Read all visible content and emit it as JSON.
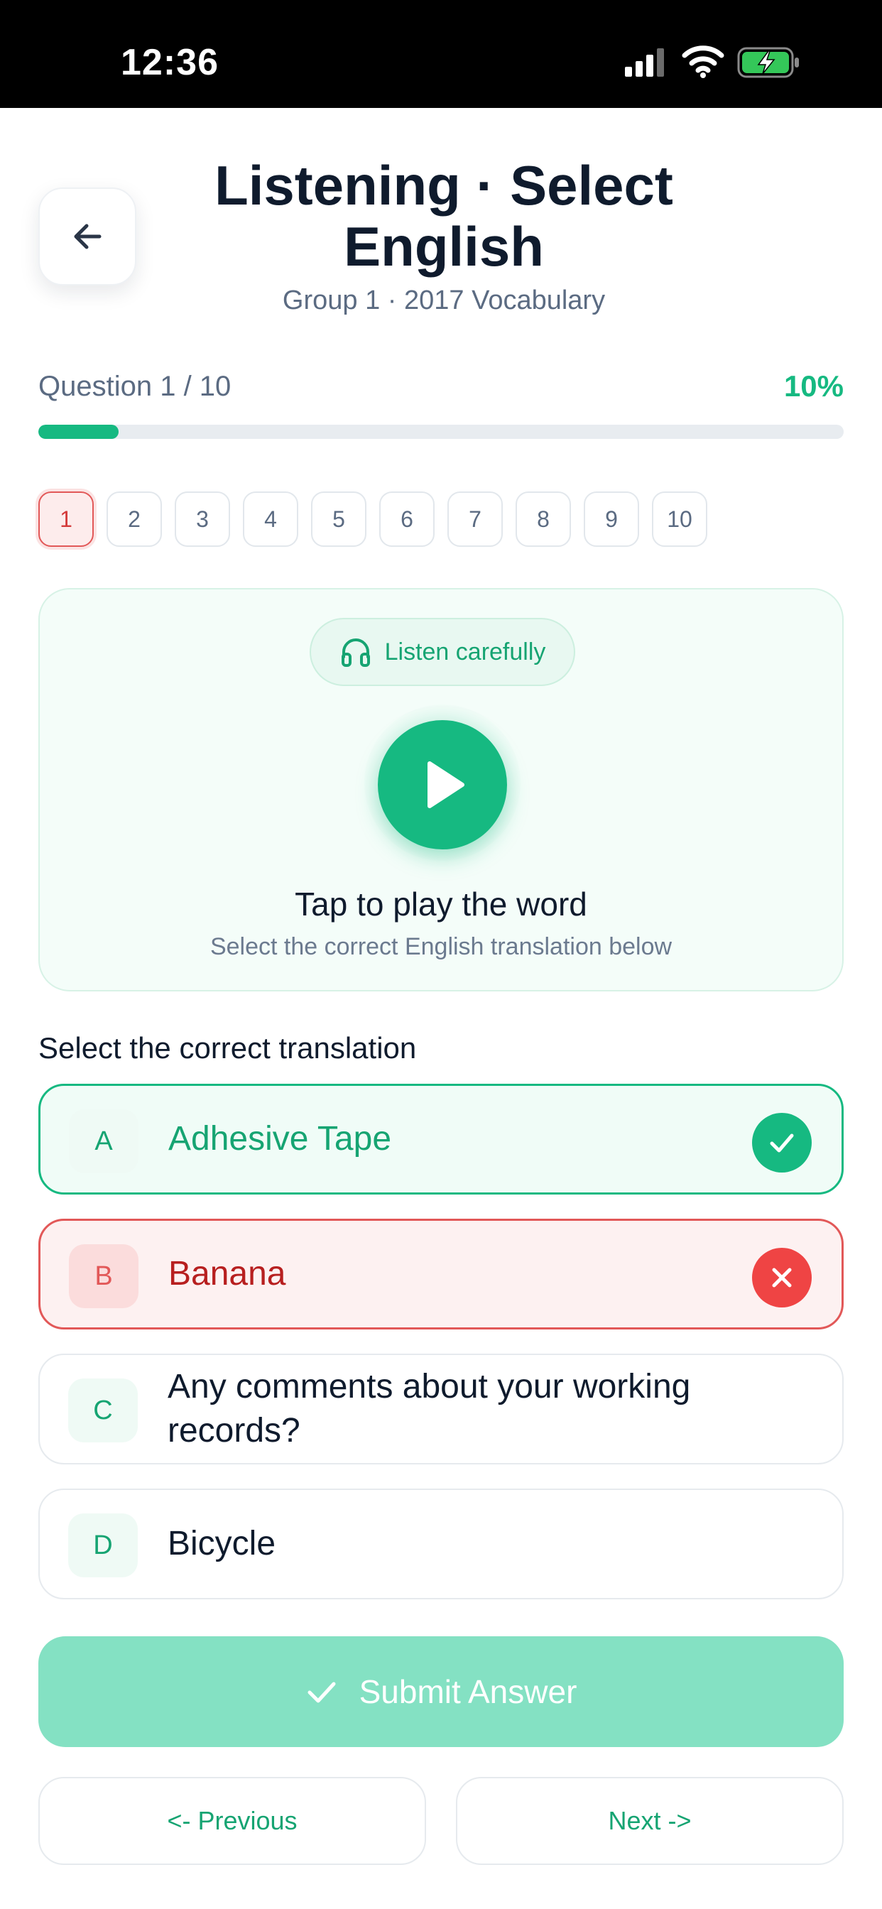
{
  "status_bar": {
    "time": "12:36"
  },
  "header": {
    "title": "Listening · Select English",
    "subtitle": "Group 1 · 2017 Vocabulary",
    "back_icon": "arrow-left-icon"
  },
  "progress": {
    "label": "Question 1 / 10",
    "percent_label": "10%",
    "fraction": 0.1,
    "accent": "#16b981"
  },
  "question_nav": [
    "1",
    "2",
    "3",
    "4",
    "5",
    "6",
    "7",
    "8",
    "9",
    "10"
  ],
  "listen_card": {
    "pill_label": "Listen carefully",
    "pill_icon": "headphones-icon",
    "play_icon": "play-icon",
    "title": "Tap to play the word",
    "subtitle": "Select the correct English translation below"
  },
  "options_label": "Select the correct translation",
  "options": [
    {
      "letter": "A",
      "text": "Adhesive Tape",
      "state": "correct",
      "icon": "check-circle-icon"
    },
    {
      "letter": "B",
      "text": "Banana",
      "state": "wrong",
      "icon": "x-circle-icon"
    },
    {
      "letter": "C",
      "text": "Any comments about your working records?",
      "state": "neutral"
    },
    {
      "letter": "D",
      "text": "Bicycle",
      "state": "neutral"
    }
  ],
  "submit": {
    "label": "Submit Answer",
    "icon": "check-icon"
  },
  "nav": {
    "previous": "<- Previous",
    "next": "Next ->"
  },
  "colors": {
    "correct": "#16b981",
    "wrong": "#e25858",
    "disabled_submit": "#84e1c3"
  }
}
